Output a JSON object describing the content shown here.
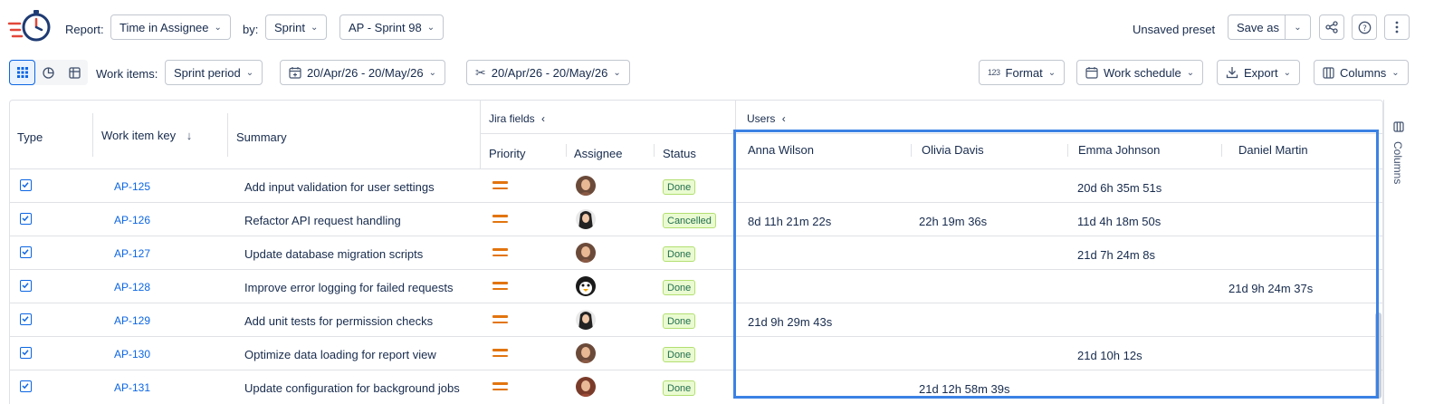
{
  "toolbar": {
    "report_label": "Report:",
    "report_value": "Time in Assignee",
    "by_label": "by:",
    "by_value": "Sprint",
    "sprint_value": "AP - Sprint 98",
    "preset_status": "Unsaved preset",
    "save_as": "Save as"
  },
  "filters": {
    "work_items_label": "Work items:",
    "period_value": "Sprint period",
    "date_range_1": "20/Apr/26 - 20/May/26",
    "date_range_2": "20/Apr/26 - 20/May/26",
    "format": "Format",
    "format_icon_text": "123",
    "work_schedule": "Work schedule",
    "export": "Export",
    "columns": "Columns"
  },
  "table": {
    "headers": {
      "type": "Type",
      "key": "Work item key",
      "summary": "Summary",
      "group_jira": "Jira fields",
      "group_users": "Users",
      "priority": "Priority",
      "assignee": "Assignee",
      "status": "Status",
      "users": [
        "Anna Wilson",
        "Olivia Davis",
        "Emma Johnson",
        "Daniel Martin"
      ]
    },
    "rows": [
      {
        "key": "AP-125",
        "summary": "Add input validation for user settings",
        "status": "Done",
        "avatar": "woman-brown",
        "times": [
          "",
          "",
          "20d 6h 35m 51s",
          ""
        ]
      },
      {
        "key": "AP-126",
        "summary": "Refactor API request handling",
        "status": "Cancelled",
        "avatar": "woman-dark",
        "times": [
          "8d 11h 21m 22s",
          "22h 19m 36s",
          "11d 4h 18m 50s",
          ""
        ]
      },
      {
        "key": "AP-127",
        "summary": "Update database migration scripts",
        "status": "Done",
        "avatar": "woman-brown",
        "times": [
          "",
          "",
          "21d 7h 24m 8s",
          ""
        ]
      },
      {
        "key": "AP-128",
        "summary": "Improve error logging for failed requests",
        "status": "Done",
        "avatar": "penguin",
        "times": [
          "",
          "",
          "",
          "21d 9h 24m 37s"
        ]
      },
      {
        "key": "AP-129",
        "summary": "Add unit tests for permission checks",
        "status": "Done",
        "avatar": "woman-dark",
        "times": [
          "21d 9h 29m 43s",
          "",
          "",
          ""
        ]
      },
      {
        "key": "AP-130",
        "summary": "Optimize data loading for report view",
        "status": "Done",
        "avatar": "woman-brown",
        "times": [
          "",
          "",
          "21d 10h 12s",
          ""
        ]
      },
      {
        "key": "AP-131",
        "summary": "Update configuration for background jobs",
        "status": "Done",
        "avatar": "woman-red",
        "times": [
          "",
          "21d 12h 58m 39s",
          "",
          ""
        ]
      }
    ]
  },
  "side_panel": {
    "label": "Columns"
  },
  "colors": {
    "accent": "#0c66e4",
    "highlight": "#3b82e4",
    "priority": "#e2740e",
    "done_bg": "#eafbd1"
  }
}
